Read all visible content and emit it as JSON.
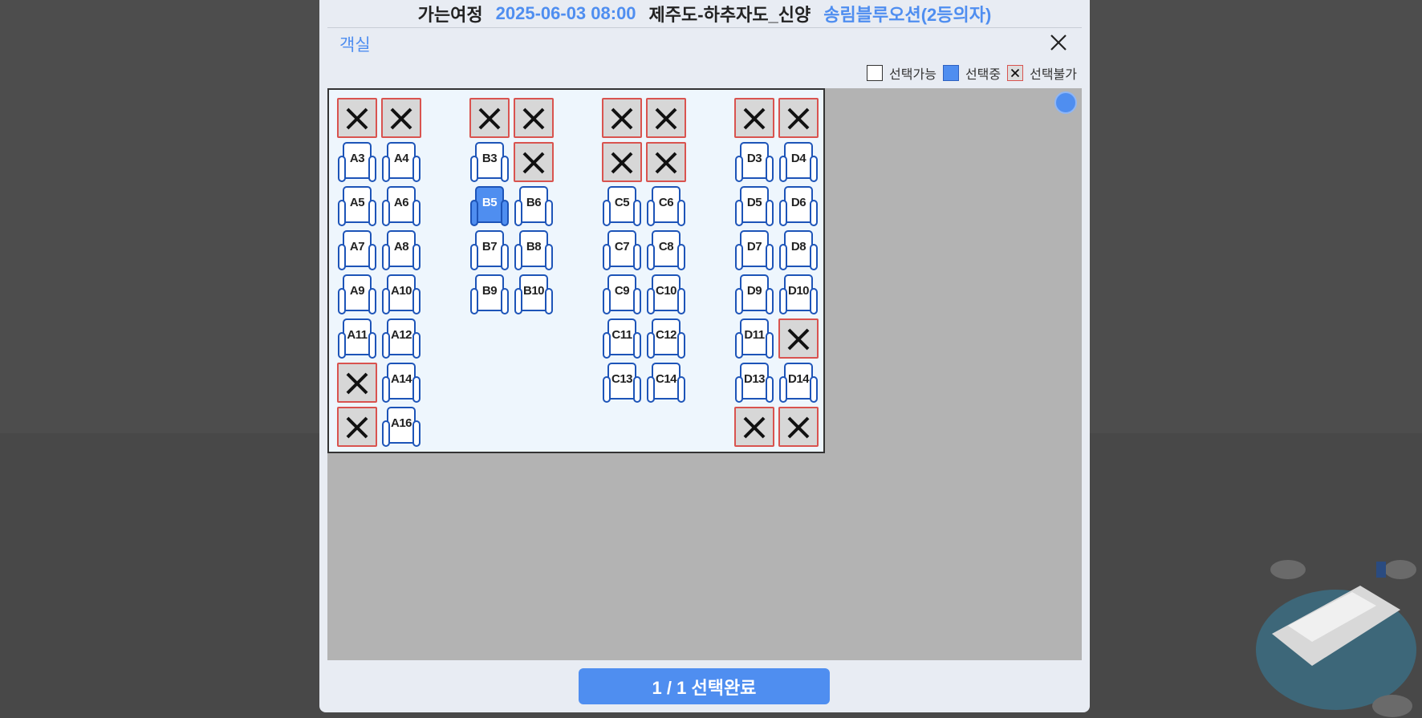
{
  "header": {
    "label": "가는여정",
    "datetime": "2025-06-03 08:00",
    "route": "제주도-하추자도_신양",
    "ship": "송림블루오션(2등의자)"
  },
  "cabin_title": "객실",
  "close_icon": "close-icon",
  "legend": {
    "available": "선택가능",
    "selected": "선택중",
    "unavailable": "선택불가"
  },
  "colors": {
    "accent": "#4f8ef0",
    "seat_outline": "#1d54b8",
    "blocked_border": "#d9534f",
    "blocked_fill": "#d7d7d7",
    "panel_bg": "#eef6fd",
    "map_bg": "#b3b3b3"
  },
  "seat_columns": [
    {
      "name": "A",
      "rows": [
        [
          {
            "label": "",
            "state": "blocked"
          },
          {
            "label": "",
            "state": "blocked"
          }
        ],
        [
          {
            "label": "A3",
            "state": "available"
          },
          {
            "label": "A4",
            "state": "available"
          }
        ],
        [
          {
            "label": "A5",
            "state": "available"
          },
          {
            "label": "A6",
            "state": "available"
          }
        ],
        [
          {
            "label": "A7",
            "state": "available"
          },
          {
            "label": "A8",
            "state": "available"
          }
        ],
        [
          {
            "label": "A9",
            "state": "available"
          },
          {
            "label": "A10",
            "state": "available"
          }
        ],
        [
          {
            "label": "A11",
            "state": "available"
          },
          {
            "label": "A12",
            "state": "available"
          }
        ],
        [
          {
            "label": "",
            "state": "blocked"
          },
          {
            "label": "A14",
            "state": "available"
          }
        ],
        [
          {
            "label": "",
            "state": "blocked"
          },
          {
            "label": "A16",
            "state": "available"
          }
        ]
      ]
    },
    {
      "name": "B",
      "rows": [
        [
          {
            "label": "",
            "state": "blocked"
          },
          {
            "label": "",
            "state": "blocked"
          }
        ],
        [
          {
            "label": "B3",
            "state": "available"
          },
          {
            "label": "",
            "state": "blocked"
          }
        ],
        [
          {
            "label": "B5",
            "state": "selected"
          },
          {
            "label": "B6",
            "state": "available"
          }
        ],
        [
          {
            "label": "B7",
            "state": "available"
          },
          {
            "label": "B8",
            "state": "available"
          }
        ],
        [
          {
            "label": "B9",
            "state": "available"
          },
          {
            "label": "B10",
            "state": "available"
          }
        ]
      ]
    },
    {
      "name": "C",
      "rows": [
        [
          {
            "label": "",
            "state": "blocked"
          },
          {
            "label": "",
            "state": "blocked"
          }
        ],
        [
          {
            "label": "",
            "state": "blocked"
          },
          {
            "label": "",
            "state": "blocked"
          }
        ],
        [
          {
            "label": "C5",
            "state": "available"
          },
          {
            "label": "C6",
            "state": "available"
          }
        ],
        [
          {
            "label": "C7",
            "state": "available"
          },
          {
            "label": "C8",
            "state": "available"
          }
        ],
        [
          {
            "label": "C9",
            "state": "available"
          },
          {
            "label": "C10",
            "state": "available"
          }
        ],
        [
          {
            "label": "C11",
            "state": "available"
          },
          {
            "label": "C12",
            "state": "available"
          }
        ],
        [
          {
            "label": "C13",
            "state": "available"
          },
          {
            "label": "C14",
            "state": "available"
          }
        ]
      ]
    },
    {
      "name": "D",
      "rows": [
        [
          {
            "label": "",
            "state": "blocked"
          },
          {
            "label": "",
            "state": "blocked"
          }
        ],
        [
          {
            "label": "D3",
            "state": "available"
          },
          {
            "label": "D4",
            "state": "available"
          }
        ],
        [
          {
            "label": "D5",
            "state": "available"
          },
          {
            "label": "D6",
            "state": "available"
          }
        ],
        [
          {
            "label": "D7",
            "state": "available"
          },
          {
            "label": "D8",
            "state": "available"
          }
        ],
        [
          {
            "label": "D9",
            "state": "available"
          },
          {
            "label": "D10",
            "state": "available"
          }
        ],
        [
          {
            "label": "D11",
            "state": "available"
          },
          {
            "label": "",
            "state": "blocked"
          }
        ],
        [
          {
            "label": "D13",
            "state": "available"
          },
          {
            "label": "D14",
            "state": "available"
          }
        ],
        [
          {
            "label": "",
            "state": "blocked"
          },
          {
            "label": "",
            "state": "blocked"
          }
        ]
      ]
    }
  ],
  "confirm_button": "1 / 1 선택완료"
}
